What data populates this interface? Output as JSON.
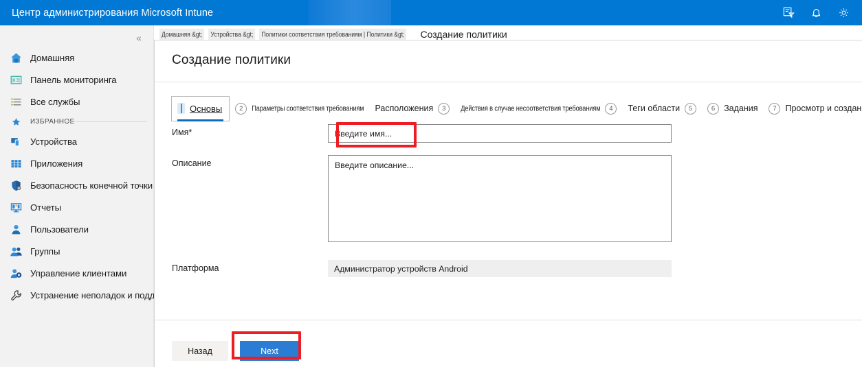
{
  "topbar": {
    "title": "Центр администрирования Microsoft Intune",
    "brand_color": "#0078d4",
    "icons": [
      {
        "name": "feedback-icon",
        "glyph": "feedback"
      },
      {
        "name": "notifications-bell-icon",
        "glyph": "bell"
      },
      {
        "name": "settings-gear-icon",
        "glyph": "gear"
      }
    ]
  },
  "sidebar": {
    "collapse_label": "«",
    "favorites_label": "ИЗБРАННОЕ",
    "items": [
      {
        "label": "Домашняя",
        "icon": "home-icon"
      },
      {
        "label": "Панель мониторинга",
        "icon": "dashboard-icon"
      },
      {
        "label": "Все службы",
        "icon": "all-services-icon"
      }
    ],
    "favorites": [
      {
        "label": "Устройства",
        "icon": "devices-icon"
      },
      {
        "label": "Приложения",
        "icon": "apps-grid-icon"
      },
      {
        "label": "Безопасность конечной точки",
        "icon": "shield-endpoint-icon"
      },
      {
        "label": "Отчеты",
        "icon": "reports-monitor-icon"
      },
      {
        "label": "Пользователи",
        "icon": "user-icon"
      },
      {
        "label": "Группы",
        "icon": "groups-icon"
      },
      {
        "label": "Управление клиентами",
        "icon": "tenant-admin-icon"
      },
      {
        "label": "Устранение неполадок и поддержка",
        "icon": "wrench-icon"
      }
    ]
  },
  "breadcrumb": {
    "segments": [
      "Домашняя &gt;",
      "Устройства &gt;",
      "Политики соответствия требованиям | Политики &gt;"
    ],
    "current": "Создание политики"
  },
  "panel": {
    "title": "Создание политики"
  },
  "wizard": {
    "tabs": [
      {
        "num": "1",
        "label": "Основы",
        "active": true,
        "compact": false
      },
      {
        "num": "2",
        "label": "Параметры соответствия требованиям",
        "active": false,
        "compact": true
      },
      {
        "num": "3",
        "label": "Расположения",
        "active": false,
        "compact": false
      },
      {
        "num": "4",
        "label": "Действия в случае несоответствия требованиям",
        "active": false,
        "compact": true
      },
      {
        "num": "5",
        "label": "Теги области",
        "active": false,
        "compact": false
      },
      {
        "num": "6",
        "label": "Задания",
        "active": false,
        "compact": false
      },
      {
        "num": "7",
        "label": "Просмотр и создание",
        "active": false,
        "compact": false
      }
    ]
  },
  "form": {
    "name": {
      "label": "Имя*",
      "placeholder": "Введите имя...",
      "value": ""
    },
    "description": {
      "label": "Описание",
      "placeholder": "Введите описание...",
      "value": ""
    },
    "platform": {
      "label": "Платформа",
      "value": "Администратор устройств Android"
    }
  },
  "footer": {
    "back_label": "Назад",
    "next_label": "Next"
  },
  "annotations": {
    "highlight_color": "#ee1d23"
  }
}
